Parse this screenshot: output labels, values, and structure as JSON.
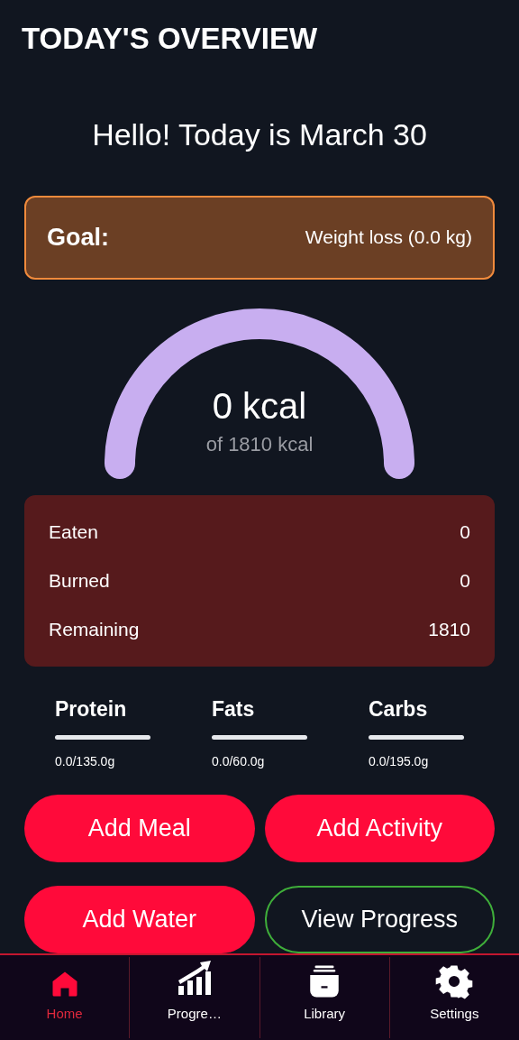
{
  "header": {
    "title": "TODAY'S OVERVIEW"
  },
  "greeting": "Hello! Today is March 30",
  "goal": {
    "label": "Goal:",
    "value": "Weight loss (0.0 kg)"
  },
  "calories": {
    "value": "0 kcal",
    "target": "of 1810 kcal"
  },
  "summary": [
    {
      "label": "Eaten",
      "value": "0"
    },
    {
      "label": "Burned",
      "value": "0"
    },
    {
      "label": "Remaining",
      "value": "1810"
    }
  ],
  "macros": [
    {
      "name": "Protein",
      "level": 0,
      "reading": "0.0/135.0g"
    },
    {
      "name": "Fats",
      "level": 0,
      "reading": "0.0/60.0g"
    },
    {
      "name": "Carbs",
      "level": 0,
      "reading": "0.0/195.0g"
    }
  ],
  "actions": [
    {
      "label": "Add Meal",
      "kind": "filled"
    },
    {
      "label": "Add Activity",
      "kind": "filled"
    },
    {
      "label": "Add Water",
      "kind": "filled"
    },
    {
      "label": "View Progress",
      "kind": "outlined"
    }
  ],
  "nav": [
    {
      "label": "Home",
      "selected": true
    },
    {
      "label": "Progre…",
      "selected": false
    },
    {
      "label": "Library",
      "selected": false
    },
    {
      "label": "Settings",
      "selected": false
    }
  ]
}
